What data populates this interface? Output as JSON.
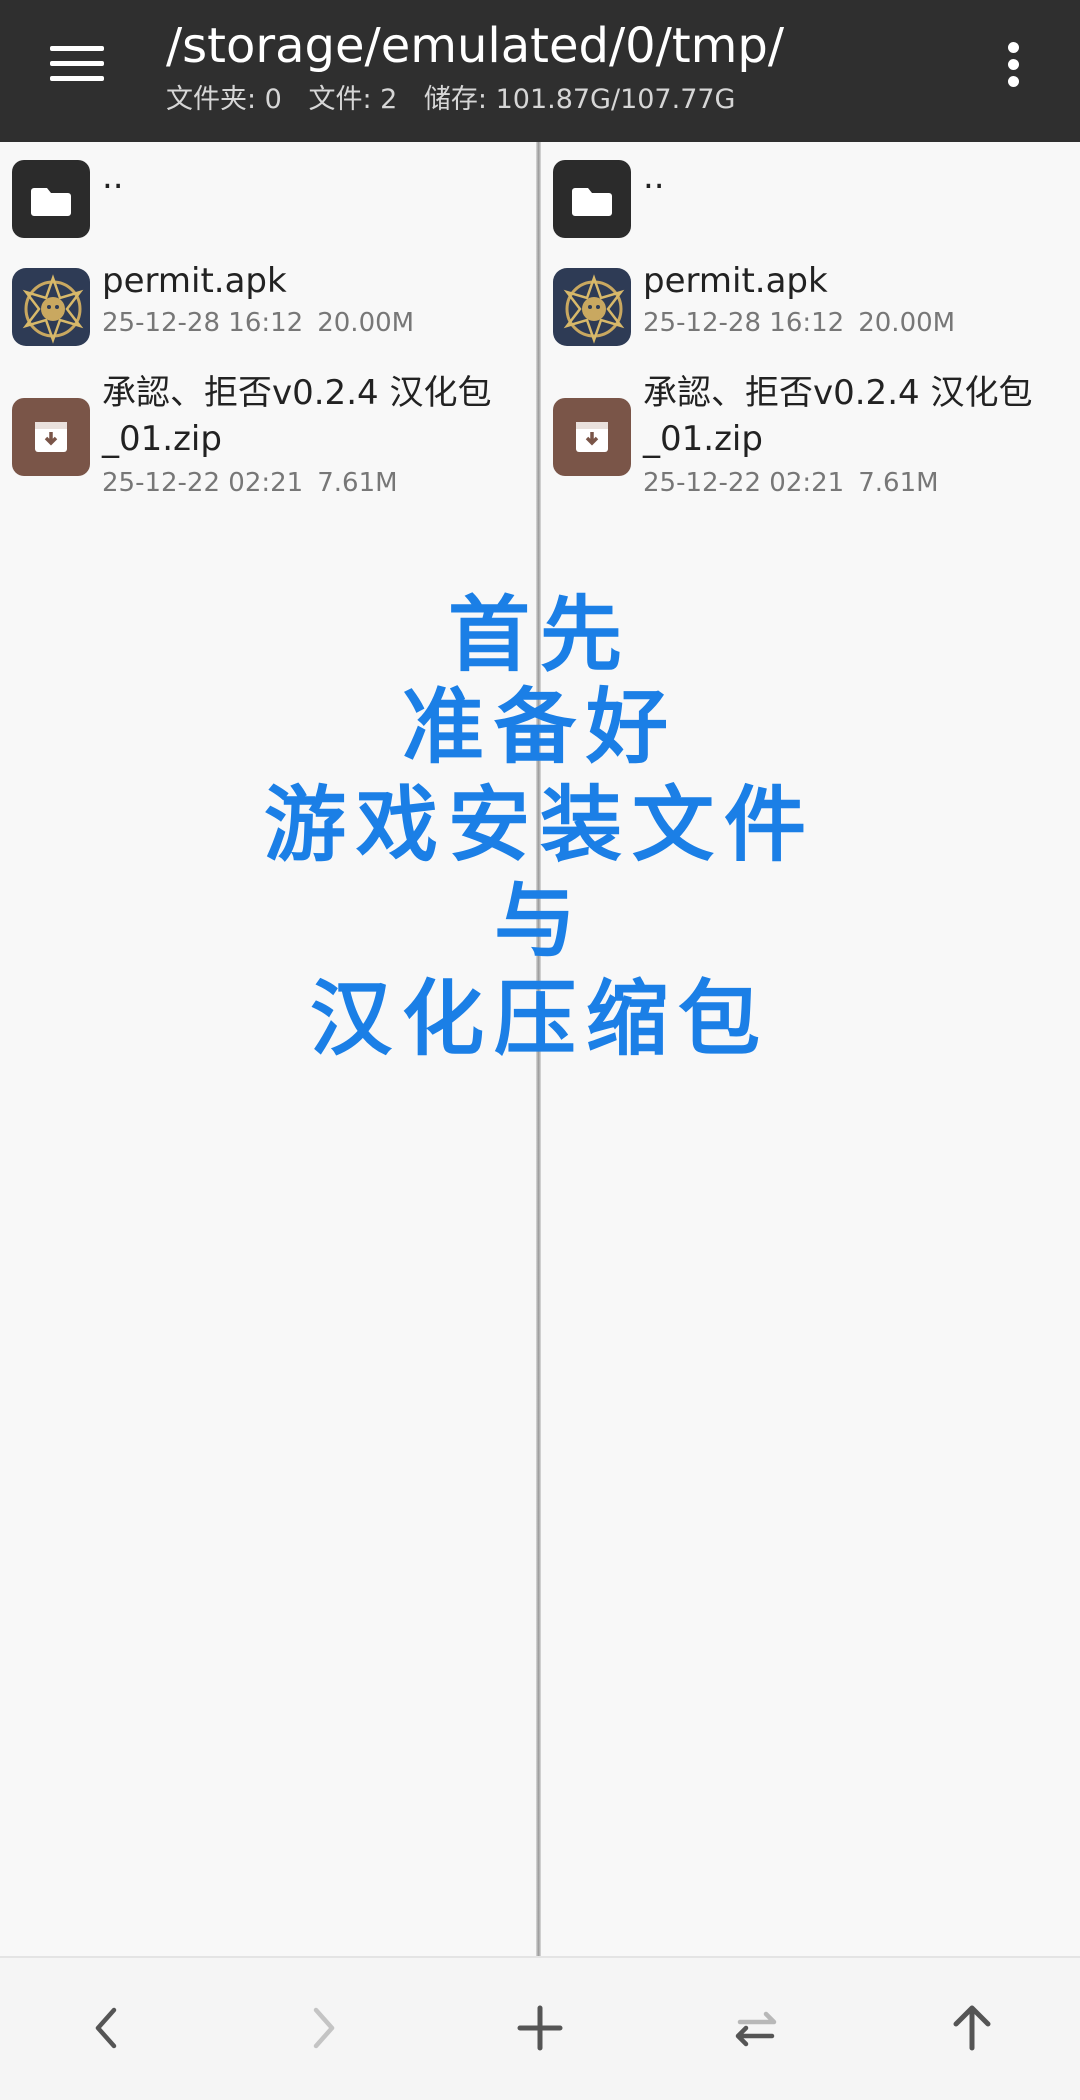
{
  "header": {
    "path": "/storage/emulated/0/tmp/",
    "folders": "文件夹: 0",
    "files": "文件: 2",
    "storage": "储存: 101.87G/107.77G"
  },
  "panes": [
    {
      "items": [
        {
          "name": "..",
          "icon": "folder-icon"
        },
        {
          "name": "permit.apk",
          "date": "25-12-28 16:12",
          "size": "20.00M",
          "icon": "app-emblem-icon"
        },
        {
          "name": "承認、拒否v0.2.4 汉化包_01.zip",
          "date": "25-12-22 02:21",
          "size": "7.61M",
          "icon": "archive-icon"
        }
      ]
    },
    {
      "items": [
        {
          "name": "..",
          "icon": "folder-icon"
        },
        {
          "name": "permit.apk",
          "date": "25-12-28 16:12",
          "size": "20.00M",
          "icon": "app-emblem-icon"
        },
        {
          "name": "承認、拒否v0.2.4 汉化包_01.zip",
          "date": "25-12-22 02:21",
          "size": "7.61M",
          "icon": "archive-icon"
        }
      ]
    }
  ],
  "overlay": {
    "lines": [
      "首先",
      "准备好",
      "游戏安装文件",
      "与",
      "汉化压缩包"
    ]
  },
  "colors": {
    "topbar": "#2f2f2f",
    "caption": "#1b7fe6",
    "archive_icon": "#7a5548",
    "apk_icon": "#2e3b55"
  },
  "bottom_nav": {
    "back": "chevron-left-icon",
    "forward": "chevron-right-icon",
    "add": "plus-icon",
    "swap": "swap-icon",
    "up": "arrow-up-icon"
  }
}
